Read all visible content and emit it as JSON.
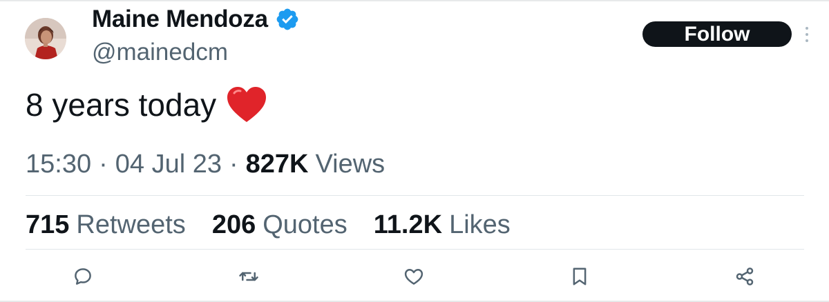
{
  "user": {
    "display_name": "Maine Mendoza",
    "handle": "@mainedcm",
    "verified": true
  },
  "header": {
    "follow_label": "Follow"
  },
  "tweet": {
    "text": "8 years today",
    "emoji": "heart-emoji",
    "time": "15:30",
    "date": "04 Jul 23",
    "separator": "·",
    "views_count": "827K",
    "views_label": "Views"
  },
  "stats": [
    {
      "count": "715",
      "label": "Retweets"
    },
    {
      "count": "206",
      "label": "Quotes"
    },
    {
      "count": "11.2K",
      "label": "Likes"
    }
  ],
  "actions": [
    "reply-icon",
    "retweet-icon",
    "like-icon",
    "bookmark-icon",
    "share-icon"
  ],
  "colors": {
    "text_primary": "#0f1419",
    "text_secondary": "#536471",
    "verified_blue": "#1d9bf0",
    "heart_red": "#e0242a",
    "divider": "#e1e6e9"
  }
}
